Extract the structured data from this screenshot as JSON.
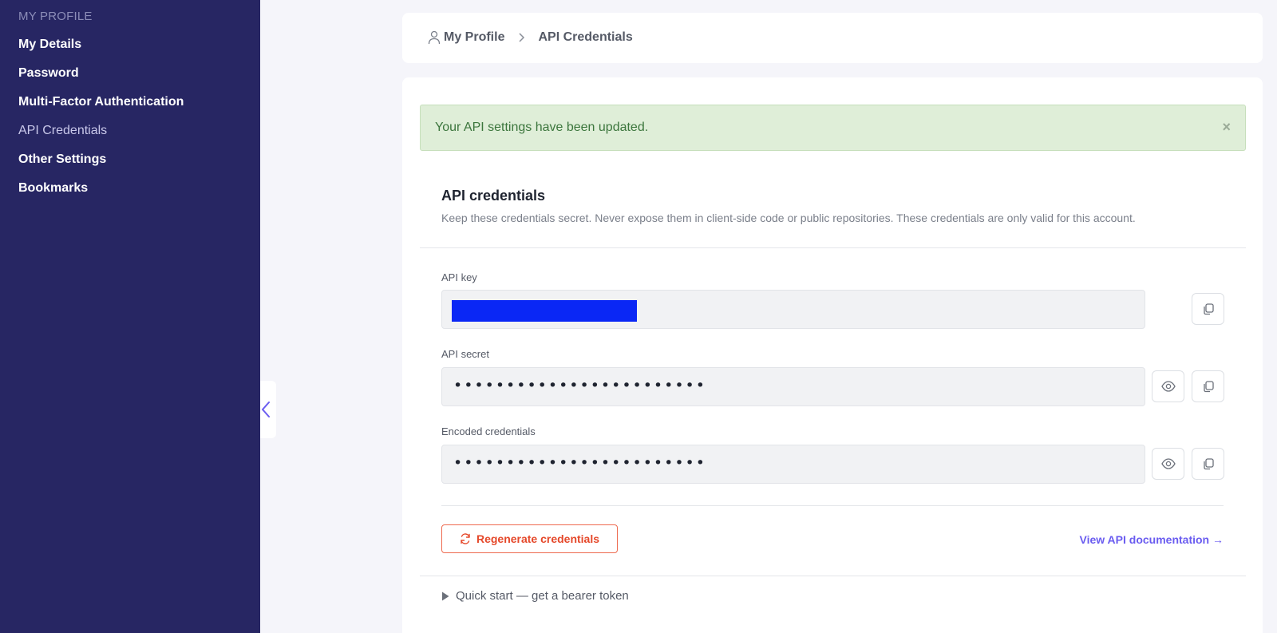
{
  "sidebar": {
    "section_title": "MY PROFILE",
    "items": [
      {
        "label": "My Details"
      },
      {
        "label": "Password"
      },
      {
        "label": "Multi-Factor Authentication"
      },
      {
        "label": "API Credentials"
      },
      {
        "label": "Other Settings"
      },
      {
        "label": "Bookmarks"
      }
    ],
    "active_item": "API Credentials"
  },
  "breadcrumb": {
    "home_label": "My Profile",
    "current_label": "API Credentials"
  },
  "alert": {
    "message": "Your API settings have been updated.",
    "close_glyph": "×"
  },
  "credentials": {
    "heading": "API credentials",
    "description": "Keep these credentials secret. Never expose them in client-side code or public repositories. These credentials are only valid for this account.",
    "api_key": {
      "label": "API key"
    },
    "api_secret": {
      "label": "API secret",
      "masked_value": "••••••••••••••••••••••••"
    },
    "encoded": {
      "label": "Encoded credentials",
      "masked_value": "••••••••••••••••••••••••"
    }
  },
  "actions": {
    "regenerate_label": "Regenerate credentials",
    "docs_label": "View API documentation →"
  },
  "quick_start": {
    "label": "Quick start — get a bearer token"
  },
  "colors": {
    "sidebar_bg": "#272663",
    "accent": "#6a5cf0",
    "danger": "#e5482a",
    "success_bg": "#dfeed8",
    "success_text": "#3c763d"
  },
  "icons": [
    "user-icon",
    "chevron-right-icon",
    "close-icon",
    "copy-icon",
    "eye-icon",
    "refresh-icon",
    "caret-right-icon",
    "chevron-left-icon"
  ]
}
